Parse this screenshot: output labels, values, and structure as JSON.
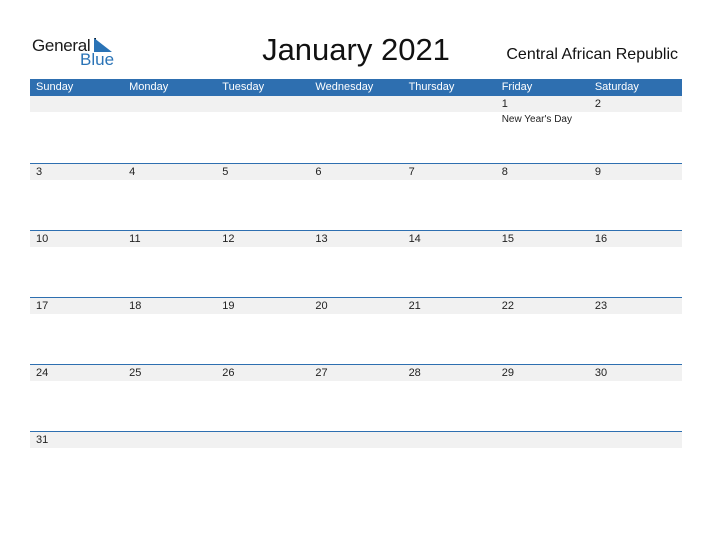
{
  "logo": {
    "line1": "General",
    "line2": "Blue"
  },
  "title": "January 2021",
  "country": "Central African Republic",
  "colors": {
    "accent": "#2e6fb0",
    "band": "#f1f1f1"
  },
  "weekdays": [
    "Sunday",
    "Monday",
    "Tuesday",
    "Wednesday",
    "Thursday",
    "Friday",
    "Saturday"
  ],
  "weeks": [
    [
      {
        "day": ""
      },
      {
        "day": ""
      },
      {
        "day": ""
      },
      {
        "day": ""
      },
      {
        "day": ""
      },
      {
        "day": "1",
        "event": "New Year's Day"
      },
      {
        "day": "2"
      }
    ],
    [
      {
        "day": "3"
      },
      {
        "day": "4"
      },
      {
        "day": "5"
      },
      {
        "day": "6"
      },
      {
        "day": "7"
      },
      {
        "day": "8"
      },
      {
        "day": "9"
      }
    ],
    [
      {
        "day": "10"
      },
      {
        "day": "11"
      },
      {
        "day": "12"
      },
      {
        "day": "13"
      },
      {
        "day": "14"
      },
      {
        "day": "15"
      },
      {
        "day": "16"
      }
    ],
    [
      {
        "day": "17"
      },
      {
        "day": "18"
      },
      {
        "day": "19"
      },
      {
        "day": "20"
      },
      {
        "day": "21"
      },
      {
        "day": "22"
      },
      {
        "day": "23"
      }
    ],
    [
      {
        "day": "24"
      },
      {
        "day": "25"
      },
      {
        "day": "26"
      },
      {
        "day": "27"
      },
      {
        "day": "28"
      },
      {
        "day": "29"
      },
      {
        "day": "30"
      }
    ],
    [
      {
        "day": "31"
      },
      {
        "day": ""
      },
      {
        "day": ""
      },
      {
        "day": ""
      },
      {
        "day": ""
      },
      {
        "day": ""
      },
      {
        "day": ""
      }
    ]
  ]
}
